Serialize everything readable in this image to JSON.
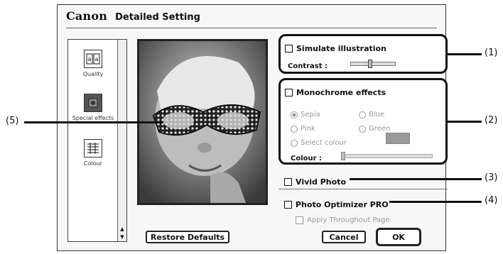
{
  "dialog": {
    "brand": "Canon",
    "title": "Detailed Setting"
  },
  "sidebar": {
    "items": [
      {
        "label": "Quality",
        "icon": "quality-icon"
      },
      {
        "label": "Special effects",
        "icon": "special-effects-icon"
      },
      {
        "label": "Colour",
        "icon": "colour-icon"
      }
    ]
  },
  "simulate": {
    "label": "Simulate illustration",
    "contrast_label": "Contrast :"
  },
  "monochrome": {
    "label": "Monochrome effects",
    "options": [
      "Sepia",
      "Blue",
      "Pink",
      "Green",
      "Select colour"
    ],
    "selected": "Sepia",
    "colour_label": "Colour :"
  },
  "vivid": {
    "label": "Vivid Photo"
  },
  "optimizer": {
    "label": "Photo Optimizer PRO",
    "apply_label": "Apply Throughout Page"
  },
  "buttons": {
    "restore": "Restore Defaults",
    "cancel": "Cancel",
    "ok": "OK"
  },
  "callouts": [
    "(1)",
    "(2)",
    "(3)",
    "(4)",
    "(5)"
  ],
  "colors": {
    "swatch": "#9a9a9a"
  }
}
